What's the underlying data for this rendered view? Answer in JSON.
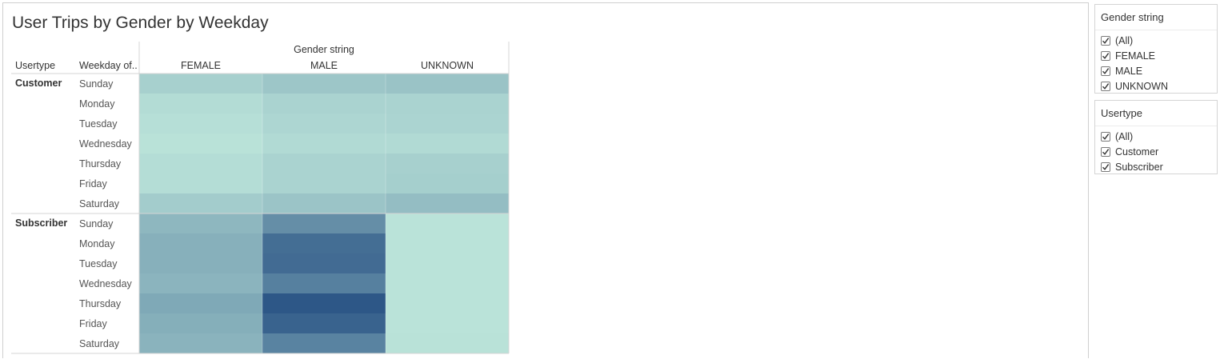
{
  "title": "User Trips by Gender by Weekday",
  "chart_data": {
    "type": "heatmap",
    "title": "User Trips by Gender by Weekday",
    "column_field": "Gender string",
    "row_field_labels": [
      "Usertype",
      "Weekday of.."
    ],
    "columns": [
      "FEMALE",
      "MALE",
      "UNKNOWN"
    ],
    "weekdays": [
      "Sunday",
      "Monday",
      "Tuesday",
      "Wednesday",
      "Thursday",
      "Friday",
      "Saturday"
    ],
    "usertypes": [
      "Customer",
      "Subscriber"
    ],
    "color_scale": [
      "#bde6db",
      "#2a5485"
    ],
    "values": {
      "Customer": {
        "FEMALE": [
          0.15,
          0.07,
          0.05,
          0.03,
          0.06,
          0.06,
          0.18
        ],
        "MALE": [
          0.22,
          0.13,
          0.11,
          0.08,
          0.13,
          0.13,
          0.23
        ],
        "UNKNOWN": [
          0.24,
          0.13,
          0.12,
          0.08,
          0.15,
          0.16,
          0.28
        ]
      },
      "Subscriber": {
        "FEMALE": [
          0.32,
          0.37,
          0.37,
          0.34,
          0.42,
          0.38,
          0.35
        ],
        "MALE": [
          0.6,
          0.82,
          0.84,
          0.7,
          0.98,
          0.9,
          0.68
        ],
        "UNKNOWN": [
          0.02,
          0.02,
          0.02,
          0.02,
          0.02,
          0.02,
          0.03
        ]
      }
    }
  },
  "filters": [
    {
      "title": "Gender string",
      "options": [
        "(All)",
        "FEMALE",
        "MALE",
        "UNKNOWN"
      ],
      "checked": [
        true,
        true,
        true,
        true
      ]
    },
    {
      "title": "Usertype",
      "options": [
        "(All)",
        "Customer",
        "Subscriber"
      ],
      "checked": [
        true,
        true,
        true
      ]
    }
  ]
}
